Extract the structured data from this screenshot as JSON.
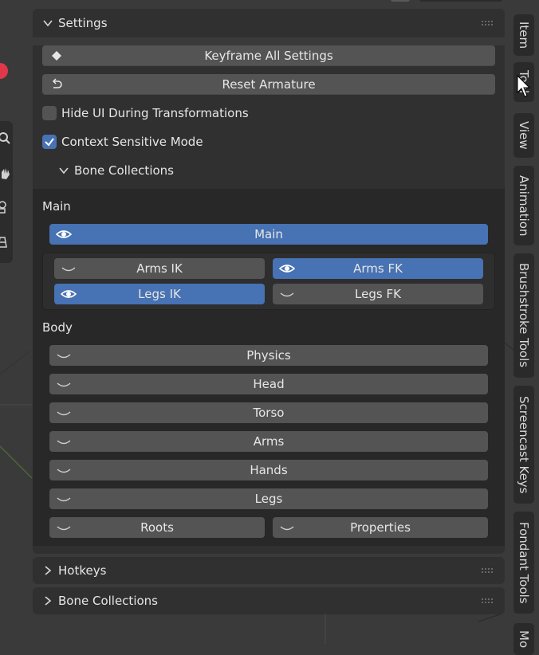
{
  "settings": {
    "title": "Settings",
    "keyframe_label": "Keyframe All Settings",
    "reset_label": "Reset Armature",
    "hide_ui": {
      "label": "Hide UI During Transformations",
      "checked": false
    },
    "context_sensitive": {
      "label": "Context Sensitive Mode",
      "checked": true
    },
    "bone_collections_sub": "Bone Collections"
  },
  "collections": {
    "main": {
      "label": "Main",
      "main_button": {
        "label": "Main",
        "visible": true
      },
      "grid": [
        {
          "label": "Arms IK",
          "visible": false
        },
        {
          "label": "Arms FK",
          "visible": true
        },
        {
          "label": "Legs IK",
          "visible": true
        },
        {
          "label": "Legs FK",
          "visible": false
        }
      ]
    },
    "body": {
      "label": "Body",
      "items": [
        {
          "label": "Physics",
          "visible": false
        },
        {
          "label": "Head",
          "visible": false
        },
        {
          "label": "Torso",
          "visible": false
        },
        {
          "label": "Arms",
          "visible": false
        },
        {
          "label": "Hands",
          "visible": false
        },
        {
          "label": "Legs",
          "visible": false
        }
      ],
      "pair": [
        {
          "label": "Roots",
          "visible": false
        },
        {
          "label": "Properties",
          "visible": false
        }
      ]
    }
  },
  "panels": {
    "hotkeys": "Hotkeys",
    "bone_collections": "Bone Collections"
  },
  "side_tabs": [
    "Item",
    "Tool",
    "View",
    "Animation",
    "Brushstroke Tools",
    "Screencast Keys",
    "Fondant Tools",
    "Mo"
  ],
  "colors": {
    "accent": "#4772b3",
    "button": "#545454",
    "panel": "#303030",
    "inner": "#282828",
    "text": "#e6e6e6"
  }
}
